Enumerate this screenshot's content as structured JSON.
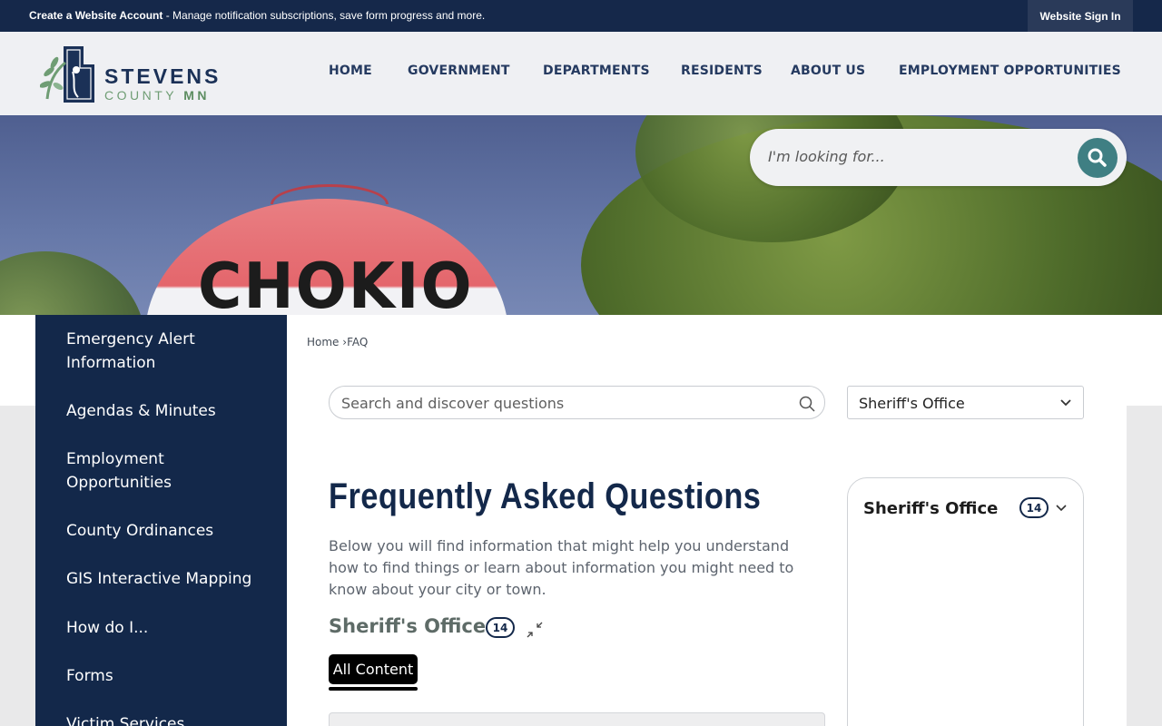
{
  "topbar": {
    "account_link": "Create a Website Account",
    "account_message": " - Manage notification subscriptions, save form progress and more.",
    "signin_label": "Website Sign In"
  },
  "logo": {
    "line1": "STEVENS",
    "line2_prefix": "COUNTY ",
    "line2_suffix": "MN"
  },
  "nav": [
    "HOME",
    "GOVERNMENT",
    "DEPARTMENTS",
    "RESIDENTS",
    "ABOUT US",
    "EMPLOYMENT OPPORTUNITIES"
  ],
  "hero": {
    "tower_text": "CHOKIO",
    "search_placeholder": "I'm looking for..."
  },
  "sidebar": {
    "items": [
      "Emergency Alert Information",
      "Agendas & Minutes",
      "Employment Opportunities",
      "County Ordinances",
      "GIS Interactive Mapping",
      "How do I...",
      "Forms",
      "Victim Services"
    ]
  },
  "breadcrumb": {
    "home": "Home",
    "separator": "›",
    "current": "FAQ"
  },
  "faq": {
    "search_placeholder": "Search and discover questions",
    "category_selected": "Sheriff's Office",
    "title": "Frequently Asked Questions",
    "description": "Below you will find information that might help you understand how to find things or learn about information you might need to know about your city or town.",
    "section_title": "Sheriff's Office",
    "section_count": "14",
    "tab_label": "All Content"
  },
  "category_card": {
    "title": "Sheriff's Office",
    "count": "14"
  },
  "colors": {
    "navy": "#13284a",
    "teal": "#3f7f83",
    "green": "#6f9d74"
  }
}
